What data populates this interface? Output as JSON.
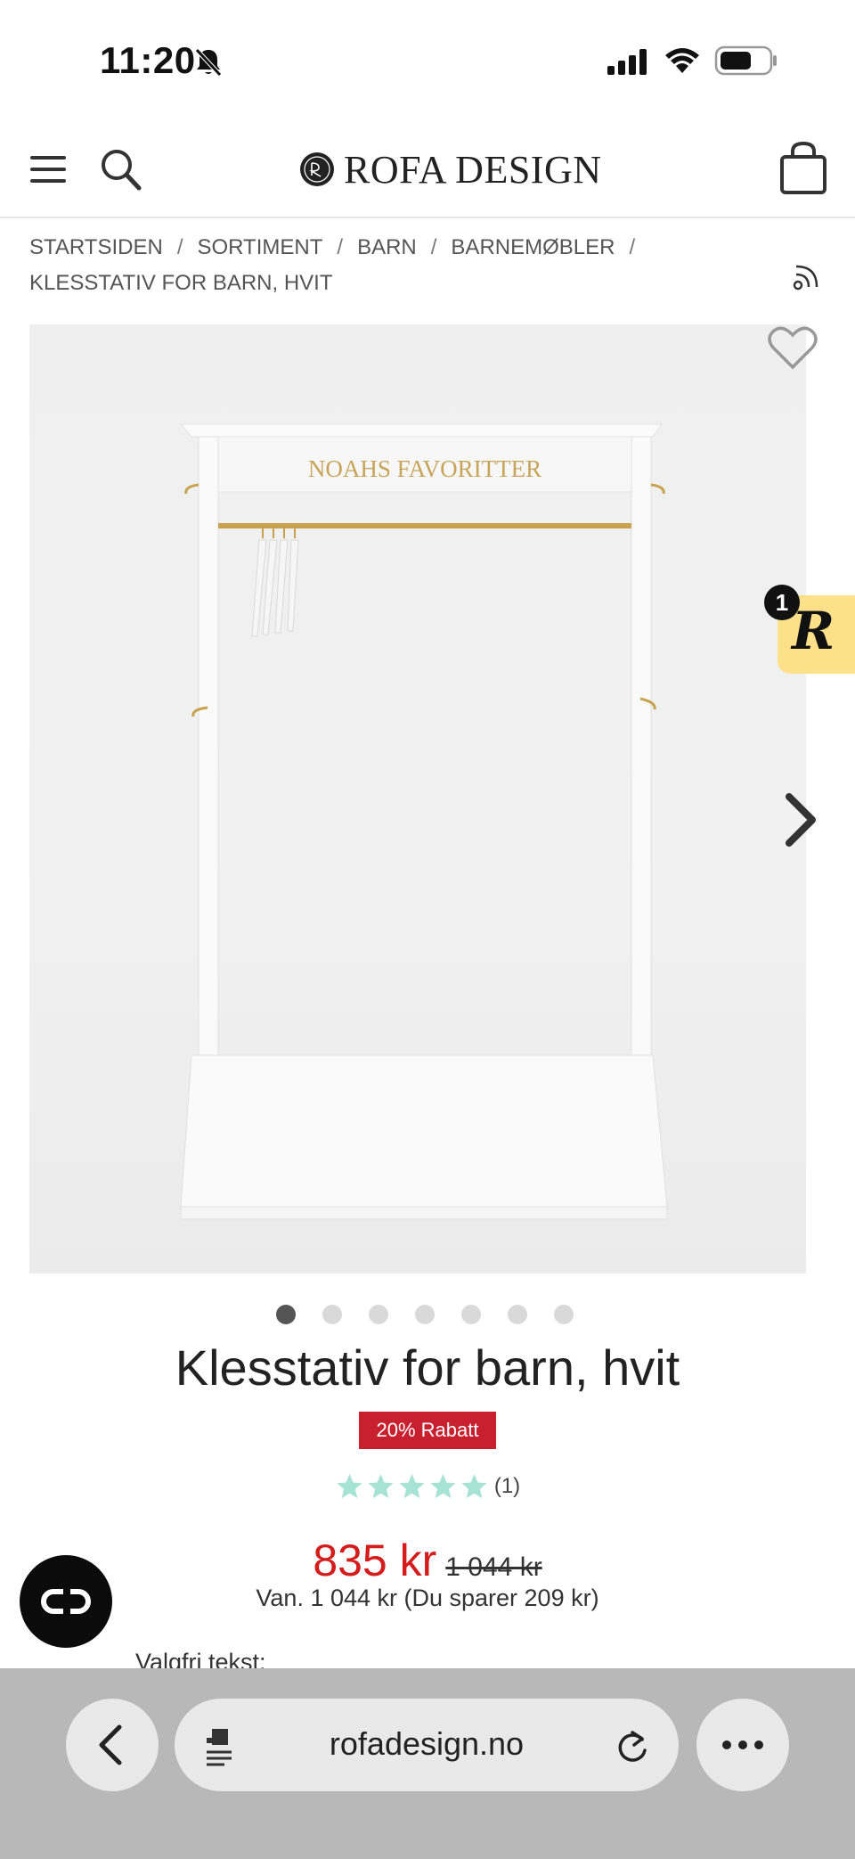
{
  "status_bar": {
    "time": "11:20"
  },
  "header": {
    "brand": "ROFA DESIGN"
  },
  "breadcrumb": {
    "items": [
      "STARTSIDEN",
      "SORTIMENT",
      "BARN",
      "BARNEMØBLER",
      "KLESSTATIV FOR BARN, HVIT"
    ]
  },
  "gallery": {
    "sign_text": "NOAHS FAVORITTER",
    "dot_count": 7,
    "active_dot": 1
  },
  "reward_widget": {
    "letter": "R",
    "badge": "1"
  },
  "product": {
    "title": "Klesstativ for barn, hvit",
    "discount_badge": "20% Rabatt",
    "rating_stars": 5,
    "rating_count": "(1)",
    "price": "835 kr",
    "old_price": "1 044 kr",
    "price_info": "Van. 1 044 kr (Du sparer 209 kr)",
    "optional_text_label": "Valgfri tekst:"
  },
  "browser": {
    "url": "rofadesign.no"
  },
  "colors": {
    "sale_red": "#d41c1c",
    "badge_red": "#c8202f",
    "star_mint": "#a6e3d5",
    "reward_yellow": "#fde08a"
  }
}
